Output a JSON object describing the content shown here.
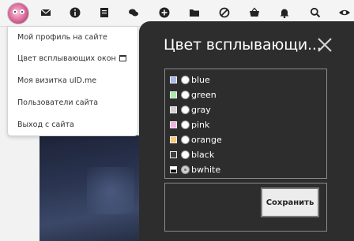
{
  "toolbar": {
    "icons": [
      "avatar",
      "mail-icon",
      "info-icon",
      "document-icon",
      "chat-icon",
      "add-icon",
      "folder-icon",
      "block-icon",
      "basket-icon",
      "bell-icon",
      "search-icon",
      "eye-icon"
    ]
  },
  "menu": {
    "items": [
      {
        "label": "Мой профиль на сайте"
      },
      {
        "label": "Цвет всплывающих окон"
      },
      {
        "label": "Моя визитка uID.me"
      },
      {
        "label": "Пользователи сайта"
      },
      {
        "label": "Выход с сайта"
      }
    ]
  },
  "popup": {
    "title": "Цвет всплывающи...",
    "options": [
      {
        "label": "blue",
        "swatch": "#a8b8e8",
        "selected": false
      },
      {
        "label": "green",
        "swatch": "#a8e8a8",
        "selected": false
      },
      {
        "label": "gray",
        "swatch": "#d0d0d0",
        "selected": false
      },
      {
        "label": "pink",
        "swatch": "#f0b0e0",
        "selected": false
      },
      {
        "label": "orange",
        "swatch": "#f8c878",
        "selected": false
      },
      {
        "label": "black",
        "swatch": "#404040",
        "selected": false
      },
      {
        "label": "bwhite",
        "swatch": "#ffffff",
        "selected": true
      }
    ],
    "save_label": "Сохранить"
  },
  "colors": {
    "popup_bg": "#2d2d2d",
    "menu_bg": "#ffffff",
    "toolbar_bg": "#f4f4f4"
  }
}
